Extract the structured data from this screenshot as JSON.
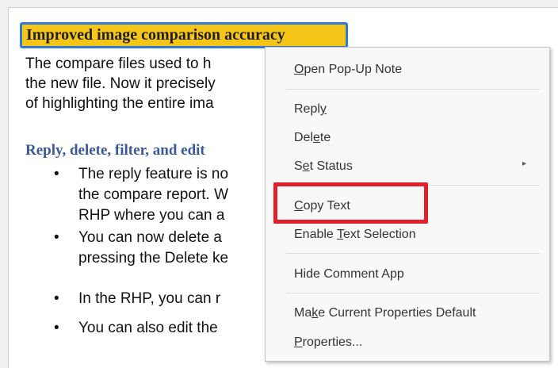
{
  "document": {
    "heading": "Improved image comparison accuracy",
    "paragraph_lines": [
      "The compare files used to h",
      "the new file. Now it precisely",
      "of highlighting the entire ima"
    ],
    "subheading": "Reply, delete, filter, and edit",
    "bullets": [
      {
        "lines": [
          "The reply feature is no",
          "the compare report. W",
          "RHP where you can a"
        ]
      },
      {
        "lines": [
          "You can now delete a",
          "pressing the Delete ke"
        ]
      },
      {
        "lines": [
          "In the RHP, you can r"
        ]
      },
      {
        "lines": [
          "You can also edit the"
        ]
      }
    ],
    "bullet_glyph": "•"
  },
  "context_menu": {
    "open_popup_note": {
      "pre": "",
      "key": "O",
      "post": "pen Pop-Up Note"
    },
    "reply": {
      "pre": "Repl",
      "key": "y",
      "post": ""
    },
    "delete": {
      "pre": "Del",
      "key": "e",
      "post": "te"
    },
    "set_status": {
      "pre": "S",
      "key": "e",
      "post": "t Status"
    },
    "set_status_arrow": "▸",
    "copy_text": {
      "pre": "",
      "key": "C",
      "post": "opy Text"
    },
    "enable_text_selection": {
      "pre": "Enable ",
      "key": "T",
      "post": "ext Selection"
    },
    "hide_comment_app": {
      "pre": "Hide Comment App",
      "key": "",
      "post": ""
    },
    "make_default": {
      "pre": "Ma",
      "key": "k",
      "post": "e Current Properties Default"
    },
    "properties": {
      "pre": "",
      "key": "P",
      "post": "roperties..."
    }
  },
  "colors": {
    "heading_bg": "#f5c518",
    "heading_border": "#2f7bd6",
    "subheading": "#3a5899",
    "highlight_box": "#e0202a"
  }
}
